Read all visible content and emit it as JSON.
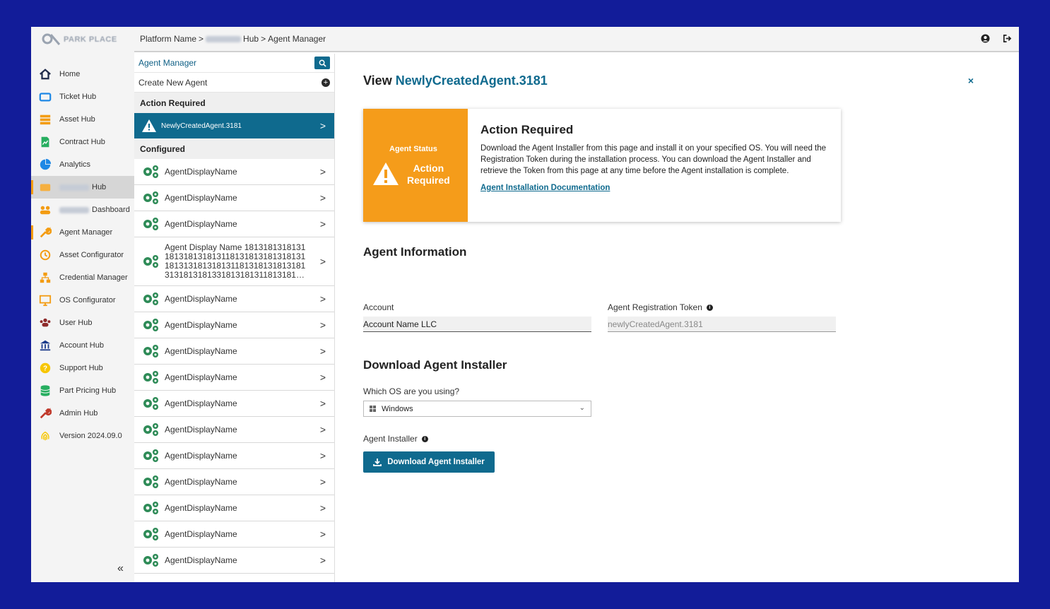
{
  "header": {
    "breadcrumb": {
      "platform": "Platform Name",
      "sep1": ">",
      "hub_suffix": "Hub",
      "sep2": ">",
      "current": "Agent Manager"
    }
  },
  "sidebar": {
    "items": [
      {
        "label": "Home",
        "icon": "home-icon"
      },
      {
        "label": "Ticket Hub",
        "icon": "ticket-icon"
      },
      {
        "label": "Asset Hub",
        "icon": "asset-icon"
      },
      {
        "label": "Contract Hub",
        "icon": "contract-icon"
      },
      {
        "label": "Analytics",
        "icon": "analytics-icon"
      },
      {
        "label": "Hub",
        "icon": "hub-icon"
      },
      {
        "label": "Dashboard",
        "icon": "dashboard-icon"
      },
      {
        "label": "Agent Manager",
        "icon": "wrench-icon"
      },
      {
        "label": "Asset Configurator",
        "icon": "history-icon"
      },
      {
        "label": "Credential Manager",
        "icon": "network-icon"
      },
      {
        "label": "OS Configurator",
        "icon": "monitor-icon"
      },
      {
        "label": "User Hub",
        "icon": "users-icon"
      },
      {
        "label": "Account Hub",
        "icon": "bank-icon"
      },
      {
        "label": "Support Hub",
        "icon": "support-icon"
      },
      {
        "label": "Part Pricing Hub",
        "icon": "database-icon"
      },
      {
        "label": "Admin Hub",
        "icon": "admin-wrench-icon"
      },
      {
        "label": "Version 2024.09.0",
        "icon": "fingerprint-icon"
      }
    ],
    "collapse": "«"
  },
  "list": {
    "search_label": "Agent Manager",
    "create_label": "Create New Agent",
    "action_required_header": "Action Required",
    "selected_agent": "NewlyCreatedAgent.3181",
    "configured_header": "Configured",
    "agents": [
      "AgentDisplayName",
      "AgentDisplayName",
      "AgentDisplayName",
      "Agent Display Name 18131813181311813181318131181318131813181311813131813181311813181318131813131813181331813181311813181…",
      "AgentDisplayName",
      "AgentDisplayName",
      "AgentDisplayName",
      "AgentDisplayName",
      "AgentDisplayName",
      "AgentDisplayName",
      "AgentDisplayName",
      "AgentDisplayName",
      "AgentDisplayName",
      "AgentDisplayName",
      "AgentDisplayName"
    ]
  },
  "main": {
    "view_prefix": "View",
    "agent_name": "NewlyCreatedAgent.3181",
    "close": "×",
    "status_card": {
      "status_label": "Agent Status",
      "status_line1": "Action",
      "status_line2": "Required",
      "title": "Action Required",
      "text": "Download the Agent Installer from this page and install it on your specified OS. You will need the Registration Token during the installation process. You can download the Agent Installer and retrieve the Token from this page at any time before the Agent installation is complete.",
      "link": "Agent Installation Documentation"
    },
    "agent_info": {
      "title": "Agent Information",
      "account_label": "Account",
      "account_value": "Account Name LLC",
      "token_label": "Agent Registration Token",
      "token_value": "newlyCreatedAgent.3181"
    },
    "download": {
      "title": "Download Agent Installer",
      "os_question": "Which OS are you using?",
      "os_selected": "Windows",
      "installer_label": "Agent Installer",
      "button_label": "Download Agent Installer"
    }
  },
  "colors": {
    "background": "#121c99",
    "accent": "#0f6a8e",
    "warning": "#f59c1a"
  }
}
